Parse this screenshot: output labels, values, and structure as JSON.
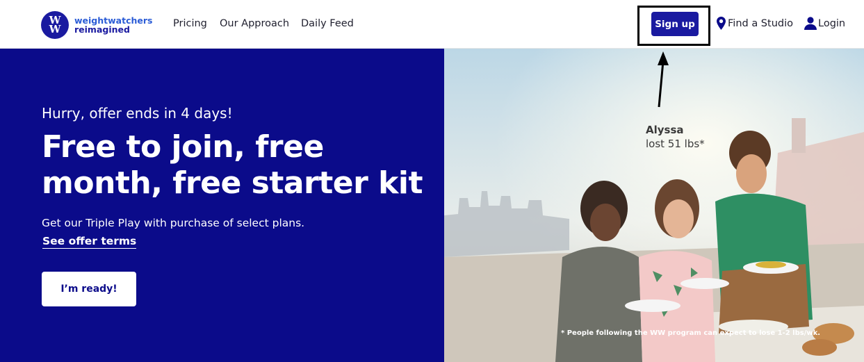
{
  "header": {
    "logo": {
      "line1": "weightwatchers",
      "line2": "reimagined",
      "mark_top": "W",
      "mark_bottom": "W"
    },
    "nav": [
      {
        "label": "Pricing"
      },
      {
        "label": "Our Approach"
      },
      {
        "label": "Daily Feed"
      }
    ],
    "signup_label": "Sign up",
    "find_studio_label": "Find a Studio",
    "login_label": "Login"
  },
  "hero": {
    "urgency": "Hurry, offer ends in 4 days!",
    "title": "Free to join, free month, free starter kit",
    "description": "Get our Triple Play with purchase of select plans.",
    "offer_link": "See offer terms",
    "cta_label": "I’m ready!",
    "testimonial": {
      "name": "Alyssa",
      "result": "lost 51 lbs*"
    },
    "disclaimer": "* People following the WW program can expect to lose 1-2 lbs/wk."
  },
  "colors": {
    "brand_navy": "#0b0b8a",
    "brand_button": "#1a1aa0",
    "logo_blue": "#2b5cd6",
    "annotation": "#000000"
  },
  "icons": [
    "ww-logo-icon",
    "location-pin-icon",
    "user-icon",
    "annotation-arrow-icon"
  ]
}
